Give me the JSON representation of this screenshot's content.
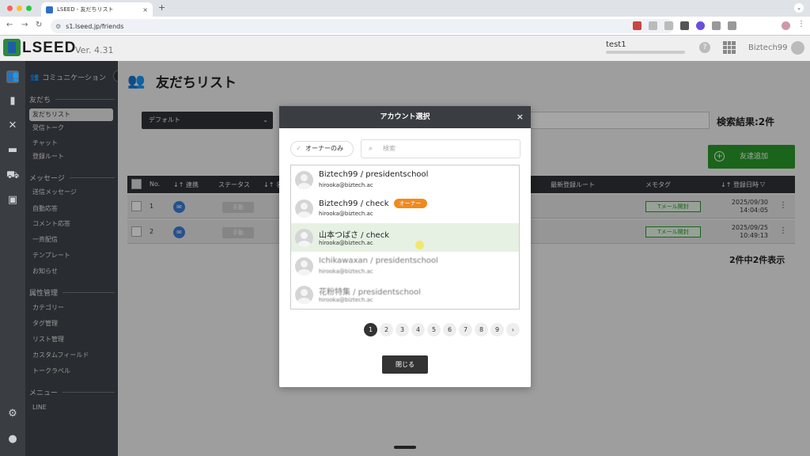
{
  "browser": {
    "tab_title": "LSEED - 友だちリスト",
    "url": "s1.lseed.jp/friends",
    "new_tab": "+",
    "tab_close": "×"
  },
  "header": {
    "logo": "LSEED",
    "version": "Ver. 4.31",
    "account_name": "test1",
    "user_name": "Biztech99"
  },
  "sidebar": {
    "top_label": "コミュニケーション",
    "sections": {
      "friends": "友だち",
      "message": "メッセージ",
      "attributes": "属性管理",
      "menu": "メニュー"
    },
    "friend_items": [
      "友だちリスト",
      "受信トーク",
      "チャット",
      "登録ルート"
    ],
    "message_items": [
      "送信メッセージ",
      "自動応答",
      "コメント応答",
      "一斉配信",
      "テンプレート",
      "お知らせ"
    ],
    "attribute_items": [
      "カテゴリー",
      "タグ管理",
      "リスト管理",
      "カスタムフィールド",
      "トークラベル"
    ],
    "menu_items": [
      "LINE"
    ]
  },
  "main": {
    "title": "友だちリスト",
    "filter_value": "デフォルト",
    "result_count": "検索結果:2件",
    "add_friend": "友達追加",
    "columns": {
      "no": "No.",
      "link": "↓↑ 連携",
      "status": "ステータス",
      "name": "↓↑ 名",
      "last_route": "最新登録ルート",
      "memo_tag": "メモタグ",
      "reg_date": "↓↑ 登録日時"
    },
    "rows": [
      {
        "no": "1",
        "status": "手動",
        "tag": "Tメール開封",
        "date": "2025/09/30",
        "time": "14:04:05"
      },
      {
        "no": "2",
        "status": "手動",
        "tag": "Tメール開封",
        "date": "2025/09/25",
        "time": "10:49:13"
      }
    ],
    "page_count": "2件中2件表示"
  },
  "modal": {
    "title": "アカウント選択",
    "close_icon": "×",
    "owner_only": "オーナーのみ",
    "search_placeholder": "検索",
    "accounts": [
      {
        "name": "Biztech99 / presidentschool",
        "email": "hirooka@biztech.ac",
        "badge": ""
      },
      {
        "name": "Biztech99 / check",
        "email": "hirooka@biztech.ac",
        "badge": "オーナー"
      },
      {
        "name": "山本つばさ / check",
        "email": "hirooka@biztech.ac",
        "badge": ""
      },
      {
        "name": "Ichikawaxan / presidentschool",
        "email": "hirooka@biztech.ac",
        "badge": ""
      },
      {
        "name": "花粉特集 / presidentschool",
        "email": "hirooka@biztech.ac",
        "badge": ""
      }
    ],
    "pages": [
      "1",
      "2",
      "3",
      "4",
      "5",
      "6",
      "7",
      "8",
      "9",
      "›"
    ],
    "close_button": "閉じる"
  }
}
